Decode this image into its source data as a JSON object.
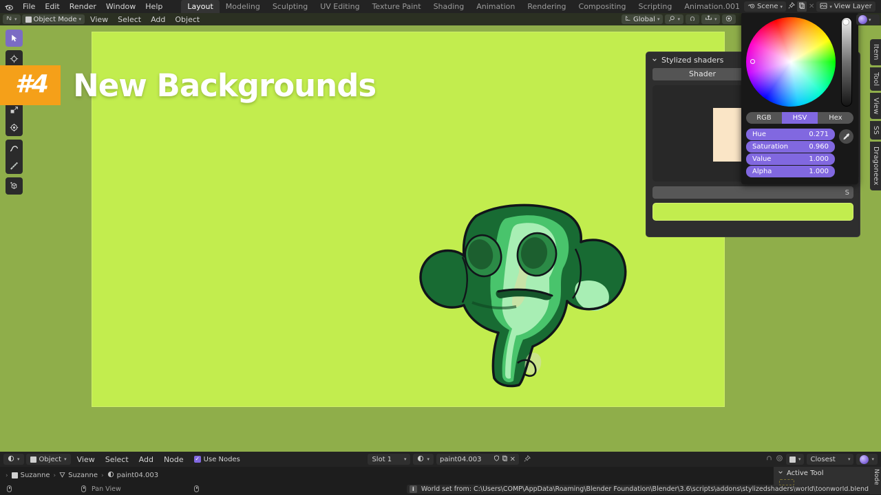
{
  "app": {
    "title": "Blender",
    "logo_icon": "blender-logo-icon"
  },
  "topbar": {
    "menus": [
      "File",
      "Edit",
      "Render",
      "Window",
      "Help"
    ],
    "workspaces": [
      {
        "label": "Layout",
        "active": true
      },
      {
        "label": "Modeling",
        "active": false
      },
      {
        "label": "Sculpting",
        "active": false
      },
      {
        "label": "UV Editing",
        "active": false
      },
      {
        "label": "Texture Paint",
        "active": false
      },
      {
        "label": "Shading",
        "active": false
      },
      {
        "label": "Animation",
        "active": false
      },
      {
        "label": "Rendering",
        "active": false
      },
      {
        "label": "Compositing",
        "active": false
      },
      {
        "label": "Scripting",
        "active": false
      },
      {
        "label": "Animation.001",
        "active": false
      }
    ],
    "add_workspace_label": "+"
  },
  "scenebar": {
    "scene_icon": "scene-icon",
    "scene_name": "Scene",
    "pin_icon": "pin-icon",
    "copy_icon": "new-scene-icon",
    "delete_icon": "unlink-scene-icon",
    "viewlayer_icon": "view-layer-icon",
    "viewlayer_name": "View Layer"
  },
  "viewport_header": {
    "editor_type_icon": "editor-type-icon",
    "mode": "Object Mode",
    "menus": [
      "View",
      "Select",
      "Add",
      "Object"
    ],
    "transform_orientation": "Global",
    "transform_icon": "orientation-icon",
    "pivot_icon": "pivot-point-icon",
    "snap_magnet_icon": "snap-magnet-icon",
    "snap_to_icon": "snap-increment-icon",
    "proportional_icon": "proportional-edit-icon",
    "falloff_icon": "proportional-falloff-icon"
  },
  "toolbar": {
    "tools": [
      {
        "name": "tweak-select-tool",
        "icon": "cursor-arrow-icon",
        "active": true
      },
      {
        "name": "cursor-tool",
        "icon": "3d-cursor-icon",
        "active": false
      },
      {
        "name": "move-tool",
        "icon": "move-arrows-icon",
        "active": false
      },
      {
        "name": "rotate-tool",
        "icon": "rotate-icon",
        "active": false
      },
      {
        "name": "scale-tool",
        "icon": "scale-icon",
        "active": false
      },
      {
        "name": "transform-tool",
        "icon": "transform-icon",
        "active": false
      },
      {
        "name": "annotate-tool",
        "icon": "pencil-icon",
        "active": false
      },
      {
        "name": "measure-tool",
        "icon": "ruler-icon",
        "active": false
      },
      {
        "name": "add-cube-tool",
        "icon": "add-cube-icon",
        "active": false
      }
    ]
  },
  "banner": {
    "number": "#4",
    "title": "New Backgrounds",
    "badge_color": "#f5a019",
    "title_color": "#ffffff"
  },
  "viewport": {
    "background_color": "#8fae4a",
    "render_region_color": "#c2ed4e",
    "object_name": "Suzanne"
  },
  "stylized_shaders_panel": {
    "title": "Stylized shaders",
    "collapse_icon": "chevron-down-icon",
    "tabs": [
      {
        "label": "Shader",
        "active": true
      },
      {
        "label": "",
        "active": false
      }
    ],
    "preview_swatch_color": "#fae5c6",
    "world_color_swatch": "#c2ed4e",
    "row_label": "S"
  },
  "color_picker": {
    "wheel_icon": "color-wheel",
    "value_slider_icon": "value-slider",
    "modes": [
      {
        "label": "RGB",
        "active": false
      },
      {
        "label": "HSV",
        "active": true
      },
      {
        "label": "Hex",
        "active": false
      }
    ],
    "fields": [
      {
        "label": "Hue",
        "value": "0.271"
      },
      {
        "label": "Saturation",
        "value": "0.960"
      },
      {
        "label": "Value",
        "value": "1.000"
      },
      {
        "label": "Alpha",
        "value": "1.000"
      }
    ],
    "eyedropper_icon": "eyedropper-icon",
    "accent_color": "#8168e0"
  },
  "npanel_tabs": [
    {
      "label": "Item"
    },
    {
      "label": "Tool"
    },
    {
      "label": "View"
    },
    {
      "label": "SS"
    },
    {
      "label": "Dragoneex"
    }
  ],
  "shader_editor_header": {
    "editor_type_icon": "shader-editor-icon",
    "shader_type": "Object",
    "menus": [
      "View",
      "Select",
      "Add",
      "Node"
    ],
    "use_nodes_label": "Use Nodes",
    "use_nodes_checked": true,
    "slot_label": "Slot 1",
    "material_icon": "material-icon",
    "material_name": "paint04.003",
    "shield_icon": "fake-user-icon",
    "copy_icon": "new-material-icon",
    "unlink_icon": "unlink-material-icon",
    "pin_icon": "pin-icon",
    "snap_icon": "snap-node-icon",
    "overlay_icon": "overlays-icon",
    "proportional_icon": "proportional-icon",
    "closest_label": "Closest",
    "material_preview_icon": "material-preview-icon"
  },
  "breadcrumb": {
    "items": [
      {
        "icon": "object-icon",
        "label": "Suzanne"
      },
      {
        "icon": "mesh-data-icon",
        "label": "Suzanne"
      },
      {
        "icon": "material-icon",
        "label": "paint04.003"
      }
    ],
    "separator": ">"
  },
  "statusbar": {
    "hints": [
      {
        "icon": "mouse-left-icon",
        "label": ""
      },
      {
        "icon": "mouse-middle-icon",
        "label": "Pan View"
      },
      {
        "icon": "mouse-right-icon",
        "label": ""
      }
    ],
    "message": "World set from: C:\\Users\\COMP\\AppData\\Roaming\\Blender Foundation\\Blender\\3.6\\scripts\\addons\\stylizedshaders\\world\\toonworld.blend",
    "message_icon": "info-icon"
  },
  "properties_panel": {
    "active_tool_label": "Active Tool",
    "collapse_icon": "chevron-down-icon",
    "side_tab": "Node"
  }
}
